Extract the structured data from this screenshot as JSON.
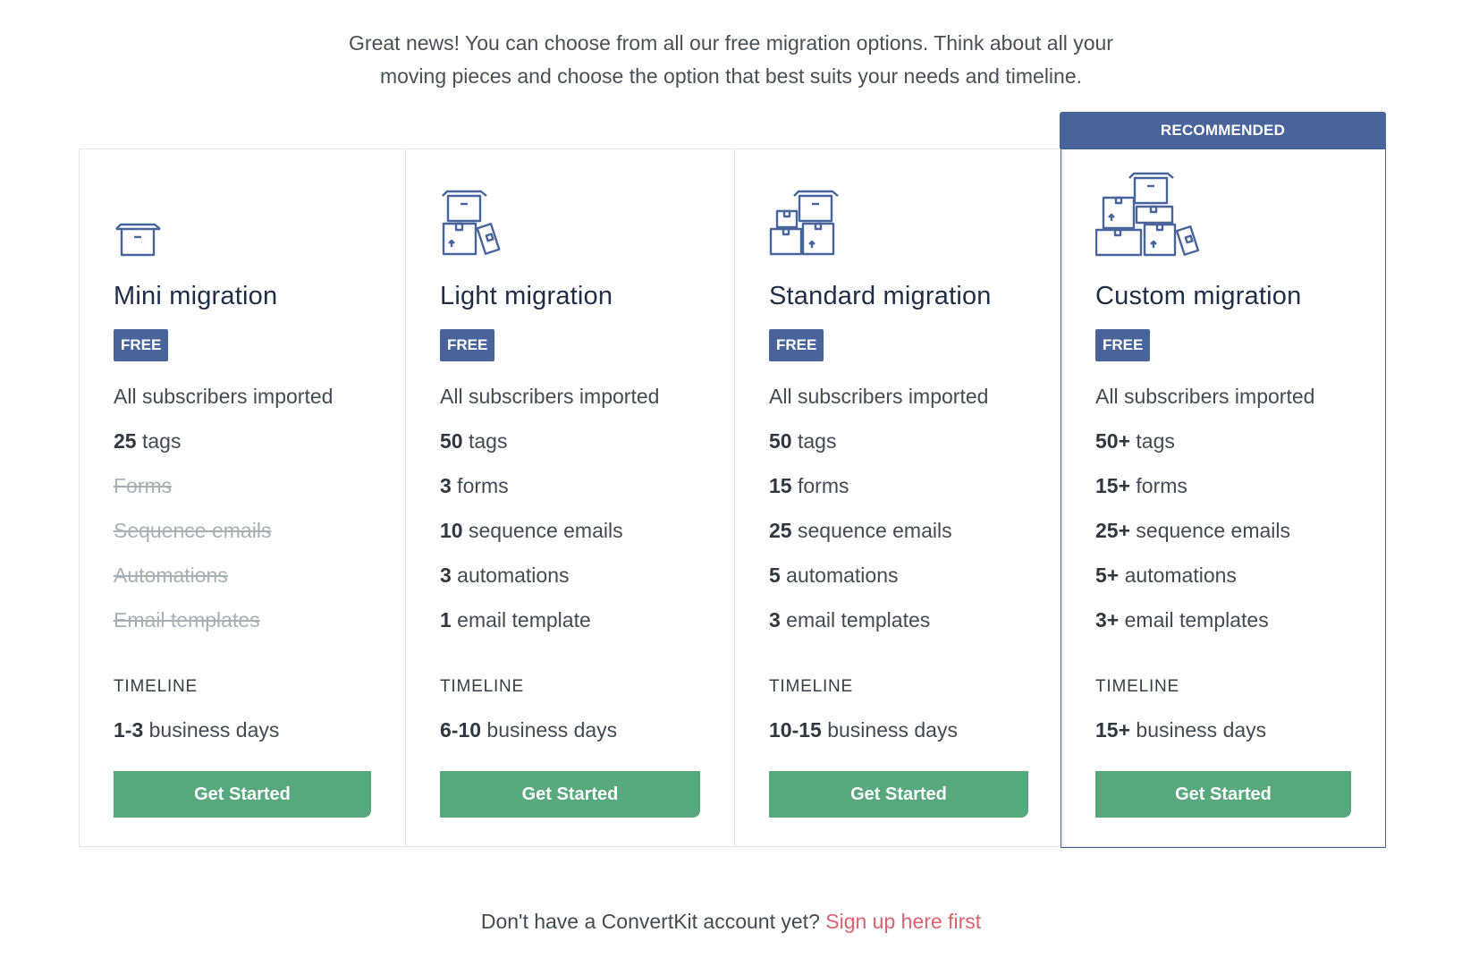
{
  "intro": {
    "line1": "Great news! You can choose from all our free migration options. Think about all your",
    "line2": "moving pieces and choose the option that best suits your needs and timeline."
  },
  "colors": {
    "brand_blue": "#48649b",
    "button_green": "#57a97d",
    "link_red": "#d9626e",
    "struck_gray": "#a8b0b4"
  },
  "recommended_label": "RECOMMENDED",
  "plans": [
    {
      "icon": "single-box-icon",
      "title": "Mini migration",
      "badge": "FREE",
      "features": [
        {
          "strong": "",
          "text": "All subscribers imported",
          "struck": false
        },
        {
          "strong": "25",
          "text": " tags",
          "struck": false
        },
        {
          "strong": "",
          "text": "Forms",
          "struck": true
        },
        {
          "strong": "",
          "text": "Sequence emails",
          "struck": true
        },
        {
          "strong": "",
          "text": "Automations",
          "struck": true
        },
        {
          "strong": "",
          "text": "Email templates",
          "struck": true
        }
      ],
      "timeline_label": "TIMELINE",
      "timeline_strong": "1-3",
      "timeline_text": " business days",
      "button": "Get Started"
    },
    {
      "icon": "stacked-boxes-small-icon",
      "title": "Light migration",
      "badge": "FREE",
      "features": [
        {
          "strong": "",
          "text": "All subscribers imported",
          "struck": false
        },
        {
          "strong": "50",
          "text": " tags",
          "struck": false
        },
        {
          "strong": "3",
          "text": " forms",
          "struck": false
        },
        {
          "strong": "10",
          "text": " sequence emails",
          "struck": false
        },
        {
          "strong": "3",
          "text": " automations",
          "struck": false
        },
        {
          "strong": "1",
          "text": " email template",
          "struck": false
        }
      ],
      "timeline_label": "TIMELINE",
      "timeline_strong": "6-10",
      "timeline_text": " business days",
      "button": "Get Started"
    },
    {
      "icon": "stacked-boxes-medium-icon",
      "title": "Standard migration",
      "badge": "FREE",
      "features": [
        {
          "strong": "",
          "text": "All subscribers imported",
          "struck": false
        },
        {
          "strong": "50",
          "text": " tags",
          "struck": false
        },
        {
          "strong": "15",
          "text": " forms",
          "struck": false
        },
        {
          "strong": "25",
          "text": " sequence emails",
          "struck": false
        },
        {
          "strong": "5",
          "text": " automations",
          "struck": false
        },
        {
          "strong": "3",
          "text": " email templates",
          "struck": false
        }
      ],
      "timeline_label": "TIMELINE",
      "timeline_strong": "10-15",
      "timeline_text": " business days",
      "button": "Get Started"
    },
    {
      "icon": "stacked-boxes-large-icon",
      "title": "Custom migration",
      "badge": "FREE",
      "features": [
        {
          "strong": "",
          "text": "All subscribers imported",
          "struck": false
        },
        {
          "strong": "50+",
          "text": " tags",
          "struck": false
        },
        {
          "strong": "15+",
          "text": " forms",
          "struck": false
        },
        {
          "strong": "25+",
          "text": " sequence emails",
          "struck": false
        },
        {
          "strong": "5+",
          "text": " automations",
          "struck": false
        },
        {
          "strong": "3+",
          "text": " email templates",
          "struck": false
        }
      ],
      "timeline_label": "TIMELINE",
      "timeline_strong": "15+",
      "timeline_text": " business days",
      "button": "Get Started"
    }
  ],
  "footer": {
    "text": "Don't have a ConvertKit account yet? ",
    "link": "Sign up here first"
  }
}
